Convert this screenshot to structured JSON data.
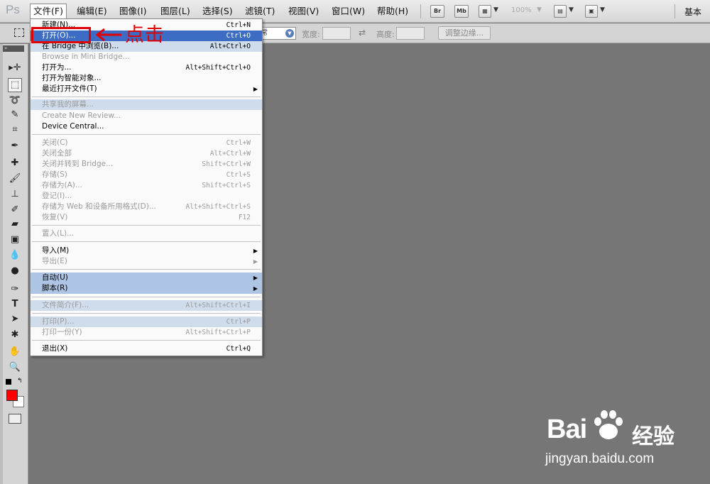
{
  "app": {
    "logo": "Ps"
  },
  "menubar": {
    "items": [
      "文件(F)",
      "编辑(E)",
      "图像(I)",
      "图层(L)",
      "选择(S)",
      "滤镜(T)",
      "视图(V)",
      "窗口(W)",
      "帮助(H)"
    ],
    "bridge_btn": "Br",
    "minibridge_btn": "Mb",
    "zoom": "100%",
    "workspace": "基本"
  },
  "options": {
    "style_value": "常",
    "width_label": "宽度:",
    "height_label": "高度:",
    "refine_edge": "调整边缘..."
  },
  "file_menu": {
    "items": [
      {
        "label": "新建(N)...",
        "shortcut": "Ctrl+N"
      },
      {
        "label": "打开(O)...",
        "shortcut": "Ctrl+O"
      },
      {
        "label": "在 Bridge 中浏览(B)...",
        "shortcut": "Alt+Ctrl+O"
      },
      {
        "label": "Browse in Mini Bridge...",
        "shortcut": ""
      },
      {
        "label": "打开为...",
        "shortcut": "Alt+Shift+Ctrl+O"
      },
      {
        "label": "打开为智能对象...",
        "shortcut": ""
      },
      {
        "label": "最近打开文件(T)",
        "shortcut": ""
      },
      {
        "label": "共享我的屏幕...",
        "shortcut": ""
      },
      {
        "label": "Create New Review...",
        "shortcut": ""
      },
      {
        "label": "Device Central...",
        "shortcut": ""
      },
      {
        "label": "关闭(C)",
        "shortcut": "Ctrl+W"
      },
      {
        "label": "关闭全部",
        "shortcut": "Alt+Ctrl+W"
      },
      {
        "label": "关闭并转到 Bridge...",
        "shortcut": "Shift+Ctrl+W"
      },
      {
        "label": "存储(S)",
        "shortcut": "Ctrl+S"
      },
      {
        "label": "存储为(A)...",
        "shortcut": "Shift+Ctrl+S"
      },
      {
        "label": "登记(I)...",
        "shortcut": ""
      },
      {
        "label": "存储为 Web 和设备所用格式(D)...",
        "shortcut": "Alt+Shift+Ctrl+S"
      },
      {
        "label": "恢复(V)",
        "shortcut": "F12"
      },
      {
        "label": "置入(L)...",
        "shortcut": ""
      },
      {
        "label": "导入(M)",
        "shortcut": ""
      },
      {
        "label": "导出(E)",
        "shortcut": ""
      },
      {
        "label": "自动(U)",
        "shortcut": ""
      },
      {
        "label": "脚本(R)",
        "shortcut": ""
      },
      {
        "label": "文件简介(F)...",
        "shortcut": "Alt+Shift+Ctrl+I"
      },
      {
        "label": "打印(P)...",
        "shortcut": "Ctrl+P"
      },
      {
        "label": "打印一份(Y)",
        "shortcut": "Alt+Shift+Ctrl+P"
      },
      {
        "label": "退出(X)",
        "shortcut": "Ctrl+Q"
      }
    ]
  },
  "annotation": {
    "text": "点击",
    "color": "#e00000"
  },
  "watermark": {
    "logo": "Bai",
    "logo2": "经验",
    "url": "jingyan.baidu.com"
  },
  "colors": {
    "foreground": "#ff0000",
    "background": "#ffffff",
    "highlight": "#3c6cc4",
    "canvas": "#767676"
  }
}
